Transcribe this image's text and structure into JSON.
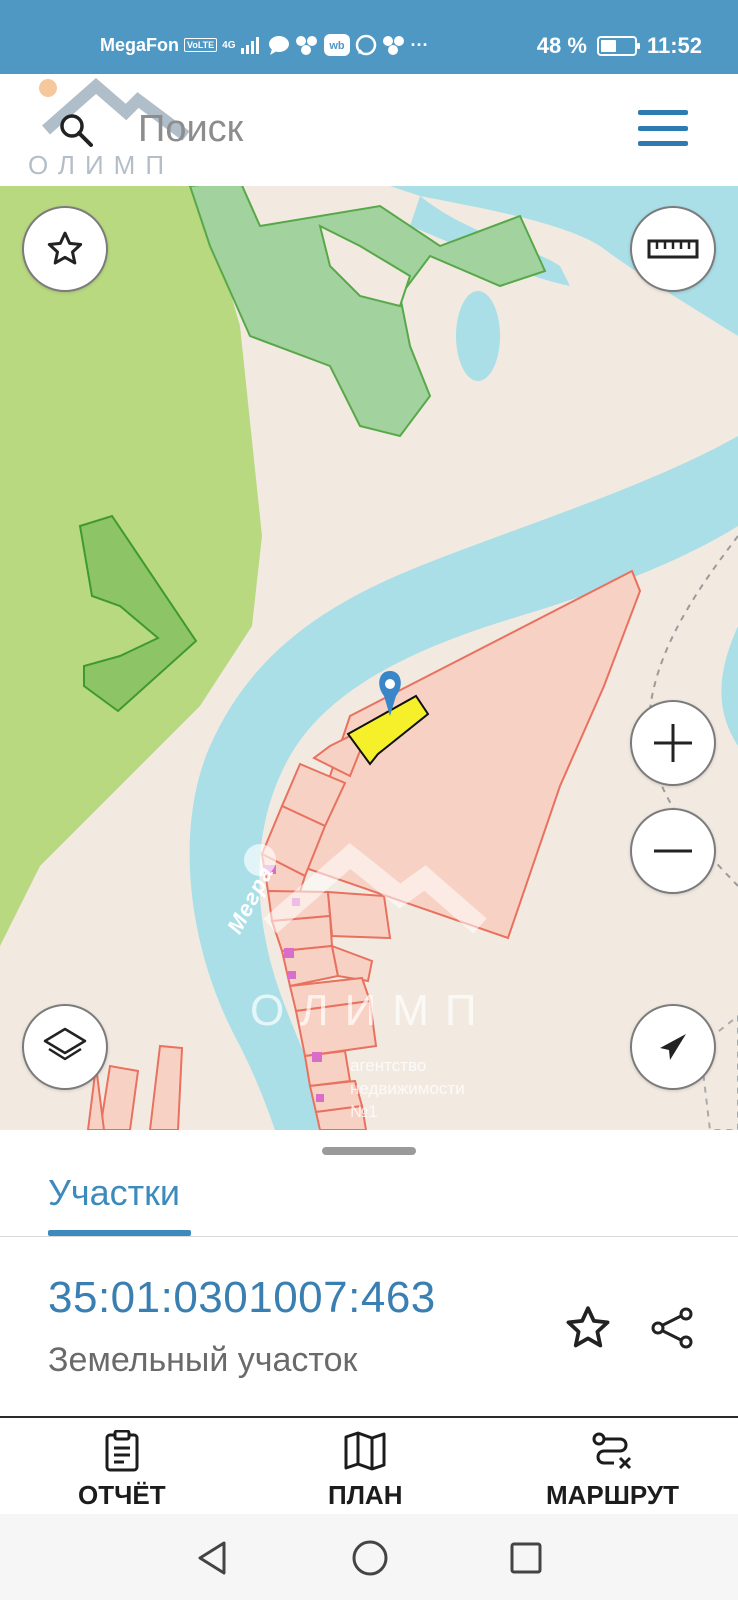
{
  "status_bar": {
    "carrier": "MegaFon",
    "volte": "VoLTE",
    "network": "4G",
    "battery_text": "48 %",
    "battery_level": 0.48,
    "time": "11:52"
  },
  "search": {
    "placeholder": "Поиск"
  },
  "watermark": {
    "name": "ОЛИМП",
    "subtitle_line1": "агентство",
    "subtitle_line2": "недвижимости",
    "subtitle_line3": "№1"
  },
  "map": {
    "river_label": "Мегра"
  },
  "sheet": {
    "tab_label": "Участки",
    "parcel_id": "35:01:0301007:463",
    "parcel_type": "Земельный участок"
  },
  "actions": {
    "report_label": "ОТЧЁТ",
    "plan_label": "ПЛАН",
    "route_label": "МАРШРУТ"
  },
  "colors": {
    "accent": "#3c8bbc",
    "status_bar": "#4f98c4",
    "water": "#aadfe8",
    "forest": "#b7d97f",
    "parcel_fill": "#f7d2c4",
    "parcel_stroke": "#e8715f",
    "selected_parcel": "#f5f02a"
  }
}
